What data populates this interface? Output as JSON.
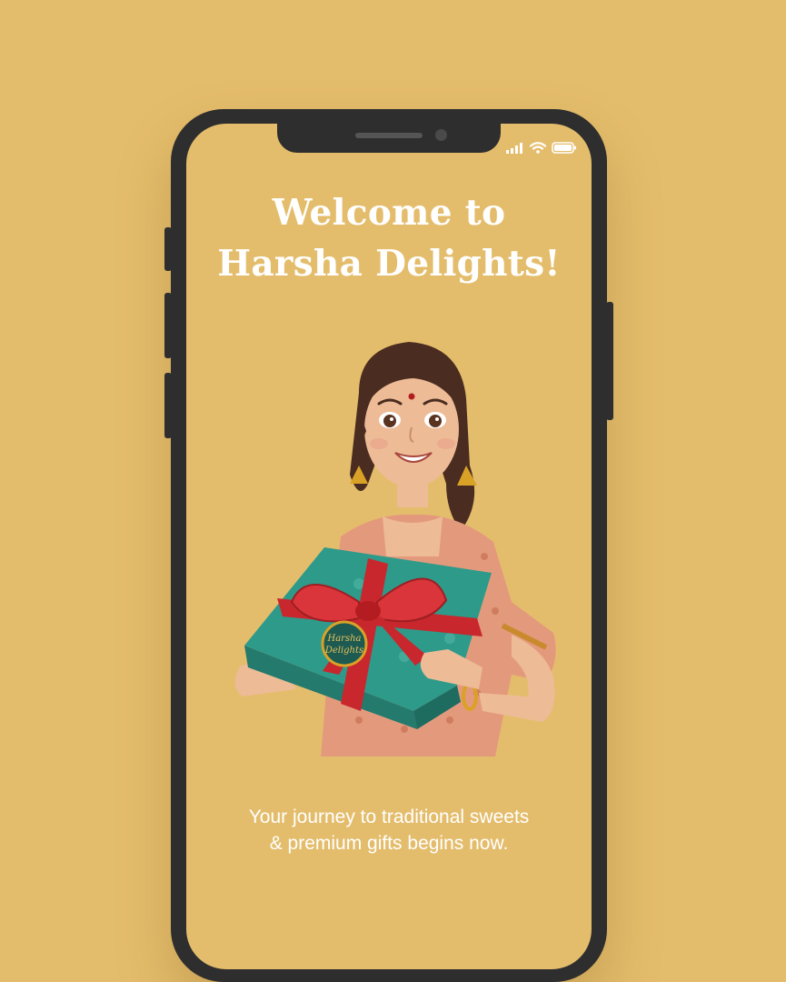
{
  "onboarding": {
    "title_line1": "Welcome to",
    "title_line2": "Harsha Delights!",
    "tagline_line1": "Your journey to traditional sweets",
    "tagline_line2": "& premium gifts begins now.",
    "gift_box_label_line1": "Harsha",
    "gift_box_label_line2": "Delights"
  },
  "status_bar": {
    "icons": [
      "signal-icon",
      "wifi-icon",
      "battery-icon"
    ]
  },
  "colors": {
    "background": "#E4BD6C",
    "phone_frame": "#2E2E2E",
    "title_text": "#FFFFFF",
    "gift_box": "#2E9A8A",
    "ribbon": "#C8272D",
    "dress": "#E39A7C"
  }
}
